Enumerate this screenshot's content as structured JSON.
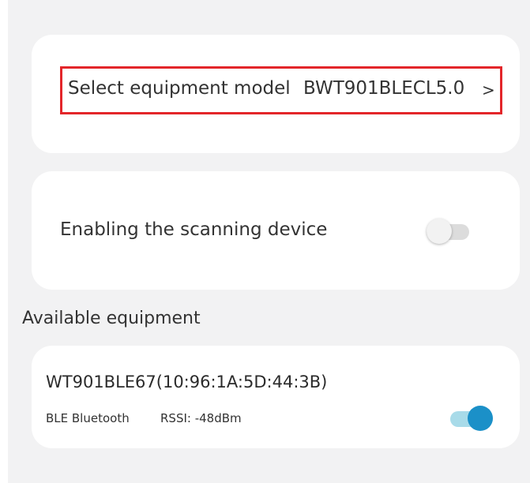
{
  "model_selector": {
    "label": "Select equipment model",
    "value": "BWT901BLECL5.0",
    "chevron": ">",
    "highlight_color": "#e3262a"
  },
  "scanning": {
    "label": "Enabling the scanning device",
    "toggle_on": false
  },
  "available": {
    "title": "Available equipment",
    "devices": [
      {
        "name": "WT901BLE67(10:96:1A:5D:44:3B)",
        "type": "BLE Bluetooth",
        "rssi": "RSSI: -48dBm",
        "connected": true,
        "accent_color": "#1b90c8"
      }
    ]
  }
}
